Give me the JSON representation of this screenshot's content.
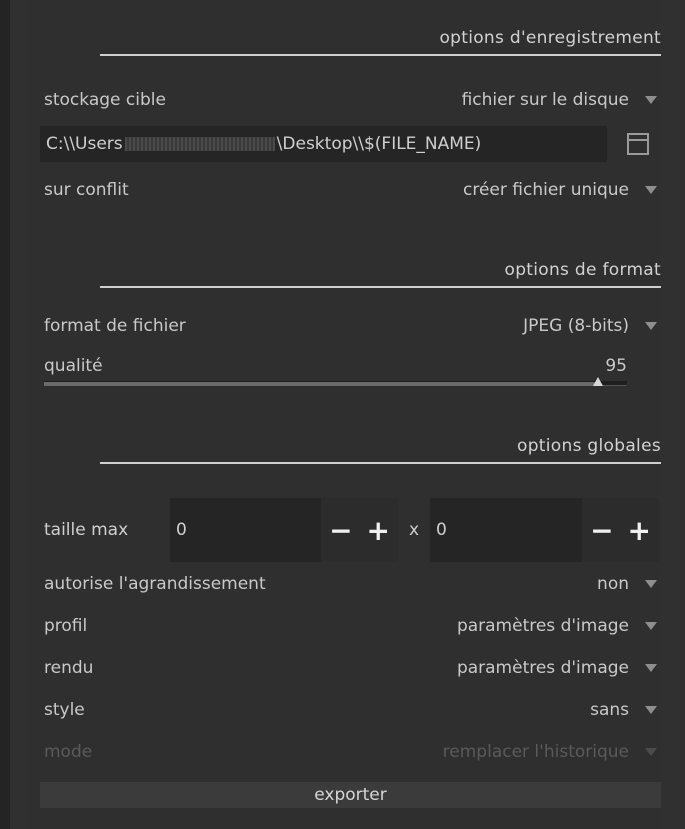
{
  "save_section": {
    "title": "options d'enregistrement",
    "target_storage": {
      "label": "stockage cible",
      "value": "fichier sur le disque"
    },
    "path": {
      "prefix": "C:\\\\Users",
      "suffix": "\\Desktop\\\\$(FILE_NAME)"
    },
    "on_conflict": {
      "label": "sur conflit",
      "value": "créer fichier unique"
    }
  },
  "format_section": {
    "title": "options de format",
    "file_format": {
      "label": "format de fichier",
      "value": "JPEG (8-bits)"
    },
    "quality": {
      "label": "qualité",
      "value": "95",
      "fraction": 0.95
    }
  },
  "global_section": {
    "title": "options globales",
    "max_size": {
      "label": "taille max",
      "width": "0",
      "height": "0",
      "separator": "x",
      "minus": "−",
      "plus": "+"
    },
    "upscale": {
      "label": "autorise l'agrandissement",
      "value": "non"
    },
    "profile": {
      "label": "profil",
      "value": "paramètres d'image"
    },
    "intent": {
      "label": "rendu",
      "value": "paramètres d'image"
    },
    "style": {
      "label": "style",
      "value": "sans"
    },
    "mode": {
      "label": "mode",
      "value": "remplacer l'historique",
      "disabled": true
    }
  },
  "export_button": {
    "label": "exporter"
  },
  "icons": {
    "dropdown": "triangle-down-icon",
    "file_browse": "folder-icon"
  }
}
